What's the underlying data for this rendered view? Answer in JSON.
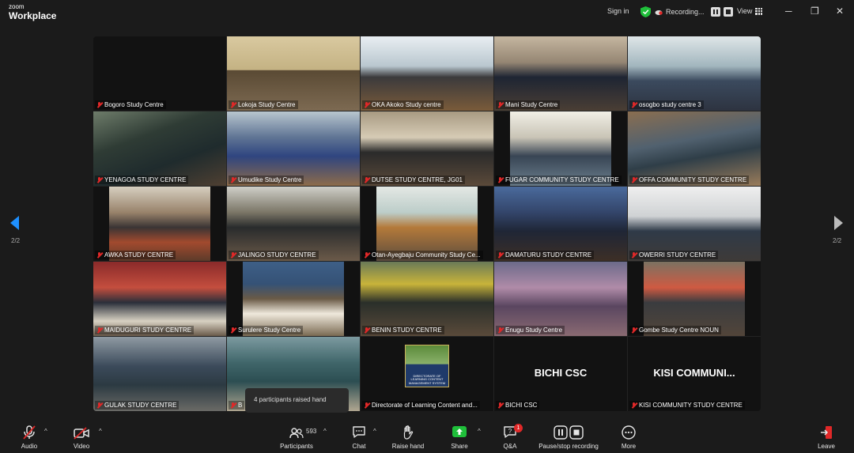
{
  "app": {
    "brand_small": "zoom",
    "brand_big": "Workplace"
  },
  "titlebar": {
    "sign_in": "Sign in",
    "recording": "Recording...",
    "view": "View"
  },
  "tiles": [
    {
      "name": "Bogoro Study Centre"
    },
    {
      "name": "Lokoja Study Centre"
    },
    {
      "name": "OKA Akoko Study centre"
    },
    {
      "name": "Mani Study Centre"
    },
    {
      "name": "osogbo study centre 3"
    },
    {
      "name": "YENAGOA STUDY CENTRE"
    },
    {
      "name": "Umudike Study Centre"
    },
    {
      "name": "DUTSE STUDY CENTRE, JG01"
    },
    {
      "name": "FUGAR COMMUNITY STUDY CENTRE"
    },
    {
      "name": "OFFA COMMUNITY STUDY CENTRE"
    },
    {
      "name": "AWKA STUDY CENTRE"
    },
    {
      "name": "JALINGO STUDY CENTRE"
    },
    {
      "name": "Otan-Ayegbaju Community Study Ce..."
    },
    {
      "name": "DAMATURU STUDY CENTRE"
    },
    {
      "name": "OWERRI STUDY CENTRE"
    },
    {
      "name": "MAIDUGURI STUDY CENTRE"
    },
    {
      "name": "Surulere Study Centre"
    },
    {
      "name": "BENIN STUDY CENTRE"
    },
    {
      "name": "Enugu Study Centre"
    },
    {
      "name": "Gombe Study Centre NOUN"
    },
    {
      "name": "GULAK STUDY CENTRE"
    },
    {
      "name": "B"
    },
    {
      "name": "Directorate of Learning Content and..."
    },
    {
      "name": "BICHI CSC",
      "display": "BICHI CSC"
    },
    {
      "name": "KISI COMMUNITY STUDY CENTRE",
      "display": "KISI  COMMUNI..."
    }
  ],
  "logo_text": "DIRECTORATE OF LEARNING CONTENT MANAGEMENT SYSTEM",
  "pagination": {
    "left": "2/2",
    "right": "2/2"
  },
  "toast": "4 participants raised hand",
  "toolbar": {
    "audio": "Audio",
    "video": "Video",
    "participants": "Participants",
    "participant_count": "593",
    "chat": "Chat",
    "raise_hand": "Raise hand",
    "share": "Share",
    "qa": "Q&A",
    "qa_badge": "1",
    "pause_stop": "Pause/stop recording",
    "more": "More",
    "leave": "Leave"
  },
  "colors": {
    "accent_share": "#1fbf3a",
    "muted_red": "#e02828",
    "nav_blue": "#1e90ff",
    "shield_green": "#1fbf3a"
  }
}
